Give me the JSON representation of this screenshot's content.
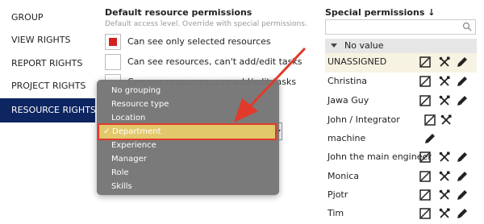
{
  "nav": {
    "items": [
      {
        "label": "GROUP",
        "active": false
      },
      {
        "label": "VIEW RIGHTS",
        "active": false
      },
      {
        "label": "REPORT RIGHTS",
        "active": false
      },
      {
        "label": "PROJECT RIGHTS",
        "active": false
      },
      {
        "label": "RESOURCE RIGHTS",
        "active": true
      }
    ]
  },
  "default_permissions": {
    "title": "Default resource permissions",
    "subtitle": "Default access level. Override with special permissions.",
    "options": [
      {
        "label": "Can see only selected resources",
        "checked": true
      },
      {
        "label": "Can see resources, can't add/edit tasks",
        "checked": false
      },
      {
        "label": "Can see resources, can add/edit tasks",
        "checked": false
      }
    ]
  },
  "grouping_dropdown": {
    "items": [
      {
        "label": "No grouping",
        "selected": false
      },
      {
        "label": "Resource type",
        "selected": false
      },
      {
        "label": "Location",
        "selected": false
      },
      {
        "label": "Department",
        "selected": true
      },
      {
        "label": "Experience",
        "selected": false
      },
      {
        "label": "Manager",
        "selected": false
      },
      {
        "label": "Role",
        "selected": false
      },
      {
        "label": "Skills",
        "selected": false
      }
    ],
    "check_mark": "✓"
  },
  "special_permissions": {
    "title": "Special permissions ↓",
    "search_placeholder": "",
    "group_label": "No value",
    "rows": [
      {
        "name": "UNASSIGNED",
        "icons": [
          "no-access-icon",
          "tools-icon",
          "pencil-icon"
        ]
      },
      {
        "name": "Christina",
        "icons": [
          "no-access-icon",
          "tools-icon",
          "pencil-icon"
        ]
      },
      {
        "name": "Jawa Guy",
        "icons": [
          "no-access-icon",
          "tools-icon",
          "pencil-icon"
        ]
      },
      {
        "name": "John / Integrator",
        "icons": [
          "no-access-icon",
          "tools-icon"
        ]
      },
      {
        "name": "machine",
        "icons": [
          "pencil-icon"
        ]
      },
      {
        "name": "John the main engineer",
        "icons": [
          "no-access-icon",
          "tools-icon",
          "pencil-icon"
        ]
      },
      {
        "name": "Monica",
        "icons": [
          "no-access-icon",
          "tools-icon",
          "pencil-icon"
        ]
      },
      {
        "name": "Pjotr",
        "icons": [
          "no-access-icon",
          "tools-icon",
          "pencil-icon"
        ]
      },
      {
        "name": "Tim",
        "icons": [
          "no-access-icon",
          "tools-icon",
          "pencil-icon"
        ]
      }
    ]
  },
  "colors": {
    "nav_active_bg": "#0d2560",
    "checkbox_fill": "#d61f1f",
    "dropdown_bg": "#767676",
    "selected_highlight": "#e2c86b",
    "annotation_red": "#e23a2a"
  }
}
